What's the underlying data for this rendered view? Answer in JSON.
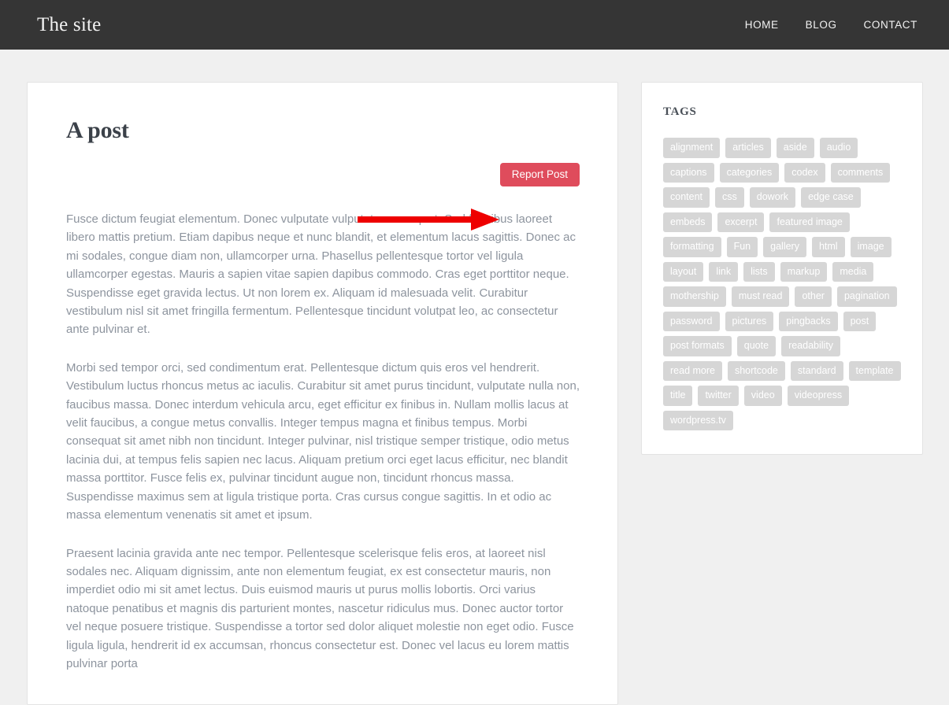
{
  "header": {
    "site_title": "The site",
    "nav": [
      {
        "label": "HOME"
      },
      {
        "label": "BLOG"
      },
      {
        "label": "CONTACT"
      }
    ]
  },
  "post": {
    "title": "A post",
    "report_button_label": "Report Post",
    "paragraphs": [
      "Fusce dictum feugiat elementum. Donec vulputate vulputate consequat. Sed faucibus laoreet libero mattis pretium. Etiam dapibus neque et nunc blandit, et elementum lacus sagittis. Donec ac mi sodales, congue diam non, ullamcorper urna. Phasellus pellentesque tortor vel ligula ullamcorper egestas. Mauris a sapien vitae sapien dapibus commodo. Cras eget porttitor neque. Suspendisse eget gravida lectus. Ut non lorem ex. Aliquam id malesuada velit. Curabitur vestibulum nisl sit amet fringilla fermentum. Pellentesque tincidunt volutpat leo, ac consectetur ante pulvinar et.",
      "Morbi sed tempor orci, sed condimentum erat. Pellentesque dictum quis eros vel hendrerit. Vestibulum luctus rhoncus metus ac iaculis. Curabitur sit amet purus tincidunt, vulputate nulla non, faucibus massa. Donec interdum vehicula arcu, eget efficitur ex finibus in. Nullam mollis lacus at velit faucibus, a congue metus convallis. Integer tempus magna et finibus tempus. Morbi consequat sit amet nibh non tincidunt. Integer pulvinar, nisl tristique semper tristique, odio metus lacinia dui, at tempus felis sapien nec lacus. Aliquam pretium orci eget lacus efficitur, nec blandit massa porttitor. Fusce felis ex, pulvinar tincidunt augue non, tincidunt rhoncus massa. Suspendisse maximus sem at ligula tristique porta. Cras cursus congue sagittis. In et odio ac massa elementum venenatis sit amet et ipsum.",
      "Praesent lacinia gravida ante nec tempor. Pellentesque scelerisque felis eros, at laoreet nisl sodales nec. Aliquam dignissim, ante non elementum feugiat, ex est consectetur mauris, non imperdiet odio mi sit amet lectus. Duis euismod mauris ut purus mollis lobortis. Orci varius natoque penatibus et magnis dis parturient montes, nascetur ridiculus mus. Donec auctor tortor vel neque posuere tristique. Suspendisse a tortor sed dolor aliquet molestie non eget odio. Fusce ligula ligula, hendrerit id ex accumsan, rhoncus consectetur est. Donec vel lacus eu lorem mattis pulvinar porta"
    ]
  },
  "sidebar": {
    "tags_widget": {
      "title": "TAGS",
      "tags": [
        "alignment",
        "articles",
        "aside",
        "audio",
        "captions",
        "categories",
        "codex",
        "comments",
        "content",
        "css",
        "dowork",
        "edge case",
        "embeds",
        "excerpt",
        "featured image",
        "formatting",
        "Fun",
        "gallery",
        "html",
        "image",
        "layout",
        "link",
        "lists",
        "markup",
        "media",
        "mothership",
        "must read",
        "other",
        "pagination",
        "password",
        "pictures",
        "pingbacks",
        "post",
        "post formats",
        "quote",
        "readability",
        "read more",
        "shortcode",
        "standard",
        "template",
        "title",
        "twitter",
        "video",
        "videopress",
        "wordpress.tv"
      ]
    }
  },
  "annotation": {
    "arrow_color": "#ee0000",
    "points_to": "Report Post"
  },
  "colors": {
    "header_bg": "#353535",
    "page_bg": "#f0f0f0",
    "card_bg": "#ffffff",
    "card_border": "#e3e3e3",
    "button_bg": "#df4c5c",
    "tag_bg": "#d6d6d6",
    "body_text": "#8d949e",
    "heading_text": "#3b4149"
  }
}
